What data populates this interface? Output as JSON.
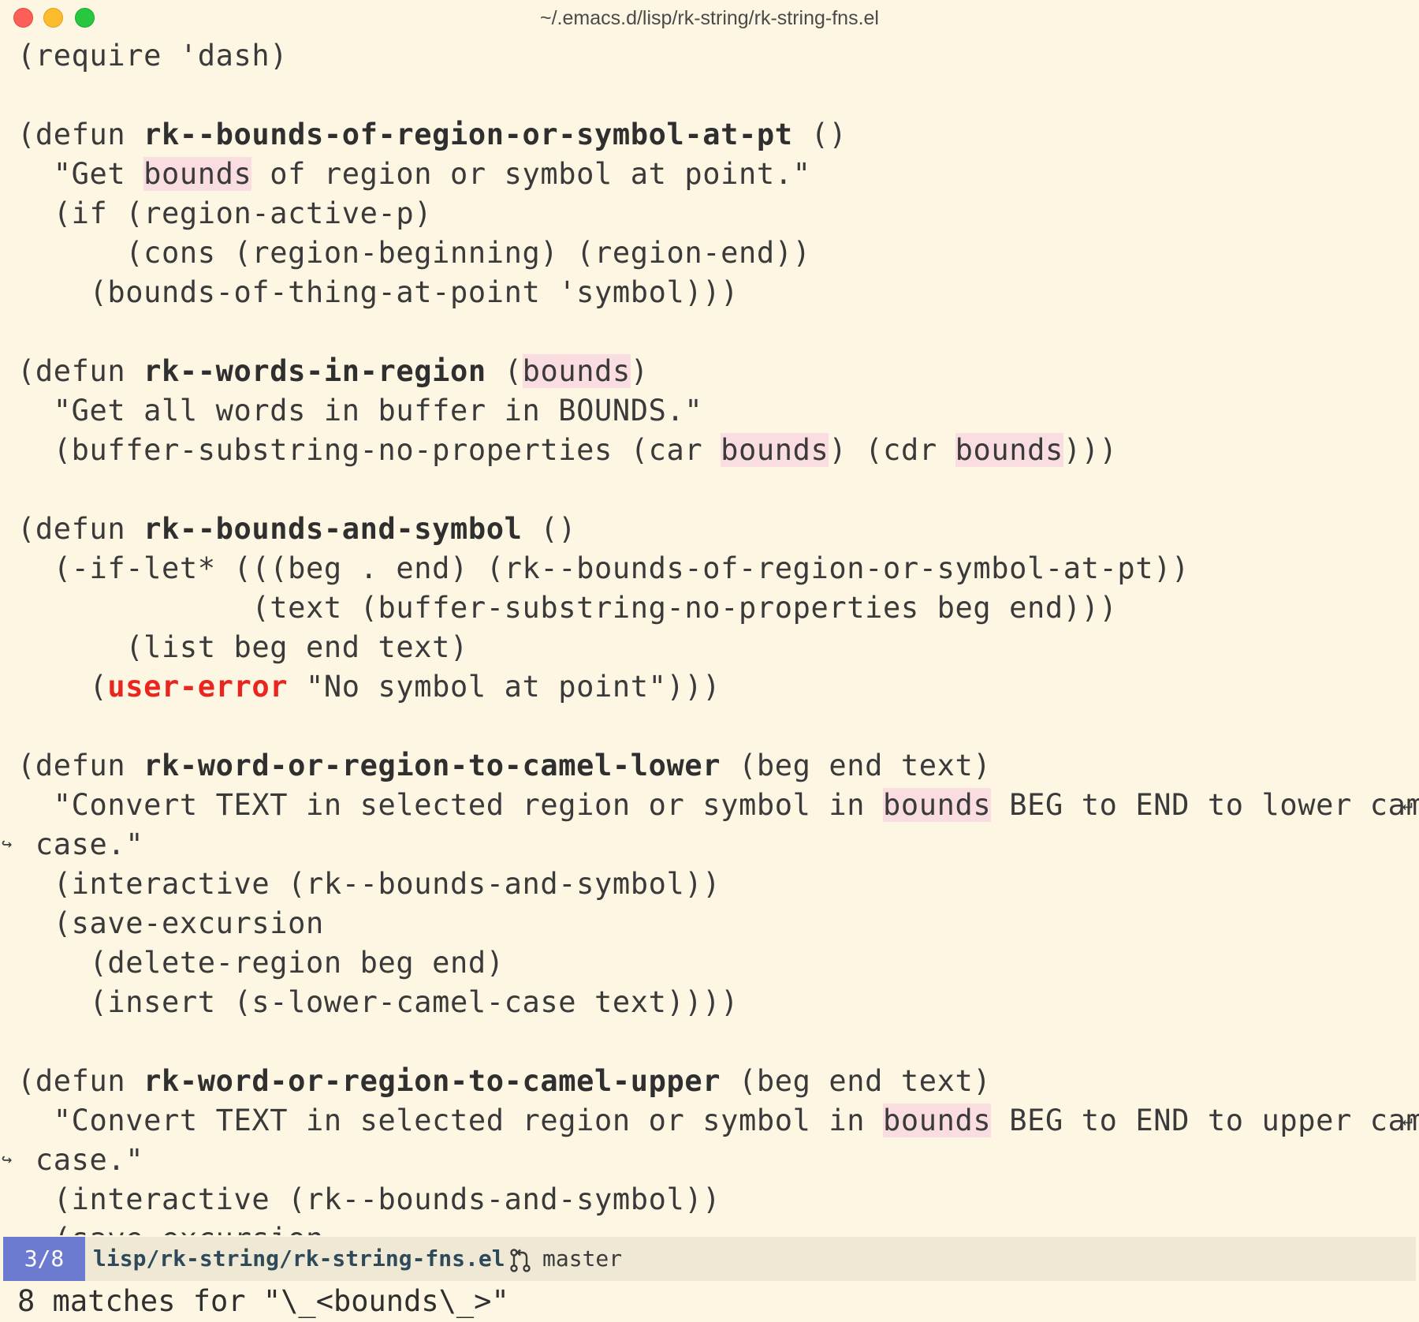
{
  "window": {
    "title": "~/.emacs.d/lisp/rk-string/rk-string-fns.el"
  },
  "code": {
    "l1": "(require 'dash)",
    "l3a": "(defun ",
    "l3fn": "rk--bounds-of-region-or-symbol-at-pt",
    "l3b": " ()",
    "l4a": "  \"Get ",
    "l4hl": "bounds",
    "l4b": " of region or symbol at point.\"",
    "l5": "  (if (region-active-p)",
    "l6": "      (cons (region-beginning) (region-end))",
    "l7": "    (bounds-of-thing-at-point 'symbol)))",
    "l9a": "(defun ",
    "l9fn": "rk--words-in-region",
    "l9b": " (",
    "l9hl": "bounds",
    "l9c": ")",
    "l10": "  \"Get all words in buffer in BOUNDS.\"",
    "l11a": "  (buffer-substring-no-properties (car ",
    "l11hl1": "bounds",
    "l11b": ") (cdr ",
    "l11hl2": "bounds",
    "l11c": ")))",
    "l13a": "(defun ",
    "l13fn": "rk--bounds-and-symbol",
    "l13b": " ()",
    "l14": "  (-if-let* (((beg . end) (rk--bounds-of-region-or-symbol-at-pt))",
    "l15": "             (text (buffer-substring-no-properties beg end)))",
    "l16": "      (list beg end text)",
    "l17a": "    (",
    "l17err": "user-error",
    "l17b": " \"No symbol at point\")))",
    "l19a": "(defun ",
    "l19fn": "rk-word-or-region-to-camel-lower",
    "l19b": " (beg end text)",
    "l20a": "  \"Convert TEXT in selected region or symbol in ",
    "l20hl": "bounds",
    "l20b": " BEG to END to lower camel",
    "l21": " case.\"",
    "l22": "  (interactive (rk--bounds-and-symbol))",
    "l23": "  (save-excursion",
    "l24": "    (delete-region beg end)",
    "l25": "    (insert (s-lower-camel-case text))))",
    "l27a": "(defun ",
    "l27fn": "rk-word-or-region-to-camel-upper",
    "l27b": " (beg end text)",
    "l28a": "  \"Convert TEXT in selected region or symbol in ",
    "l28hl": "bounds",
    "l28b": " BEG to END to upper camel",
    "l29": " case.\"",
    "l30": "  (interactive (rk--bounds-and-symbol))",
    "l31": "  (save-excursion",
    "wrap_right": "↵",
    "wrap_left": "↪"
  },
  "modeline": {
    "match_index": "3/8",
    "buffer_path": "lisp/rk-string/rk-string-fns.el",
    "branch": "master",
    "branch_icon": "git-branch-icon"
  },
  "echo_area": {
    "message": "8 matches for \"\\_<bounds\\_>\""
  },
  "colors": {
    "background": "#fdf6e3",
    "match_highlight": "#fadde1",
    "error_keyword": "#e8261f",
    "modeline_badge": "#6c7bd0"
  }
}
